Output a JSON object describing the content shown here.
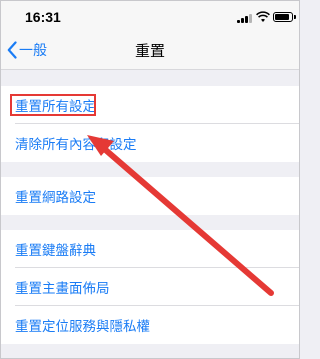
{
  "status_bar": {
    "time": "16:31",
    "icons": [
      "signal-icon",
      "wifi-icon",
      "battery-icon"
    ]
  },
  "nav": {
    "back_label": "一般",
    "title": "重置",
    "accent_color": "#1a7cf5"
  },
  "groups": [
    {
      "items": [
        {
          "label": "重置所有設定"
        },
        {
          "label": "清除所有內容和設定"
        }
      ]
    },
    {
      "items": [
        {
          "label": "重置網路設定"
        }
      ]
    },
    {
      "items": [
        {
          "label": "重置鍵盤辭典"
        },
        {
          "label": "重置主畫面佈局"
        },
        {
          "label": "重置定位服務與隱私權"
        }
      ]
    }
  ],
  "annotation": {
    "color": "#e53935"
  }
}
